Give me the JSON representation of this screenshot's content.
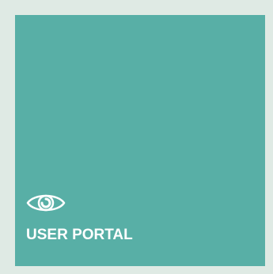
{
  "tile": {
    "label": "USER PORTAL",
    "icon": "eye-icon",
    "background_color": "#58afa6",
    "text_color": "#ffffff"
  },
  "page": {
    "background_color": "#dfeae4"
  }
}
